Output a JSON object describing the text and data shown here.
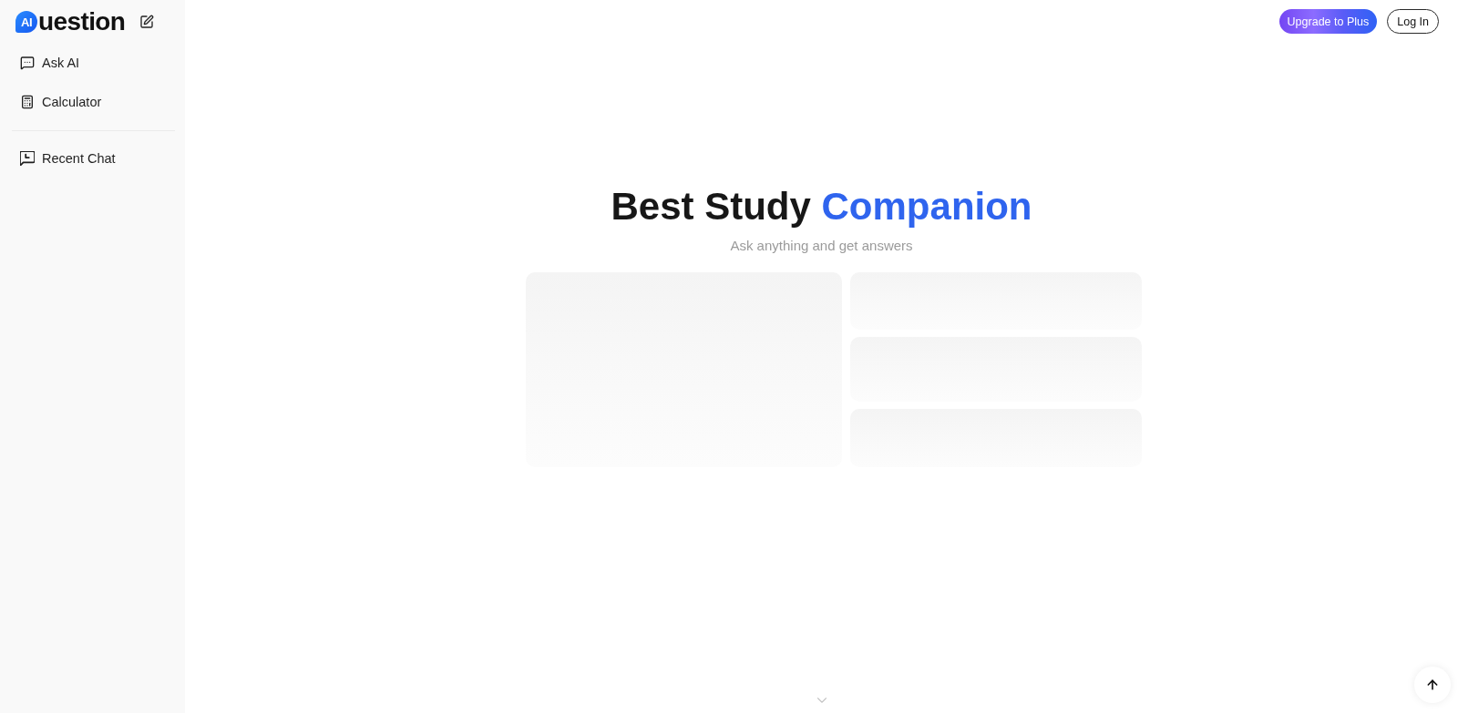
{
  "sidebar": {
    "logo": {
      "mark": "AI",
      "wordmark": "uestion"
    },
    "nav": [
      {
        "label": "Ask AI",
        "kind": "chat",
        "selected": false
      },
      {
        "label": "Calculator",
        "kind": "calculator",
        "selected": false
      }
    ],
    "recent": [
      {
        "label": "Recent Chat",
        "kind": "history",
        "selected": false
      }
    ]
  },
  "header": {
    "buttons": [
      {
        "label": "Upgrade to Plus",
        "kind": "primary"
      },
      {
        "label": "Log In",
        "kind": "outline"
      }
    ]
  },
  "hero": {
    "title": "Best Study",
    "highlight": "Companion",
    "subtitle": "Ask anything and get answers"
  }
}
